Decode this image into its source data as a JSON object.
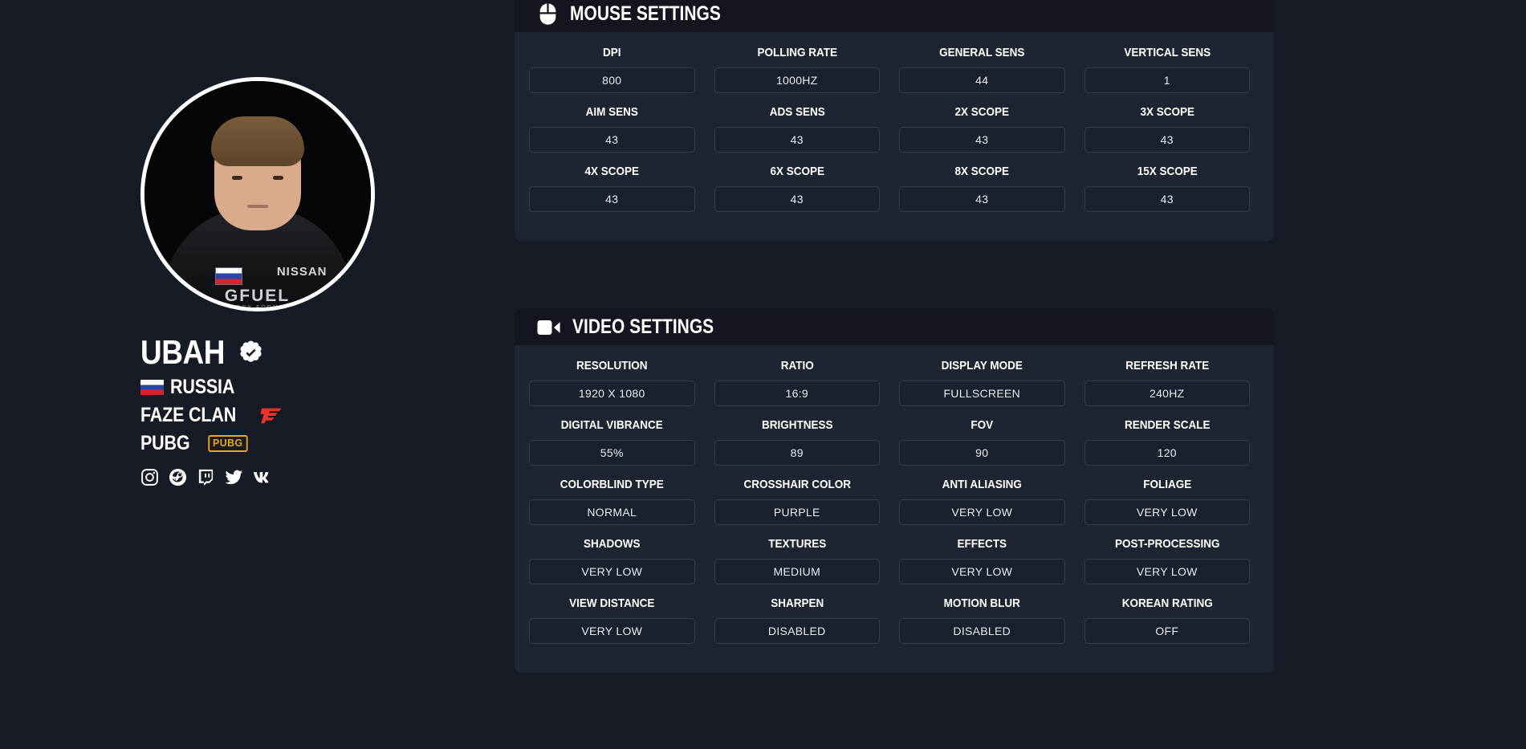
{
  "profile": {
    "avatar_alt": "player-portrait",
    "name": "UBAH",
    "verified": true,
    "country": "RUSSIA",
    "team": "FAZE CLAN",
    "game": "PUBG",
    "game_badge_label": "PUBG",
    "socials": [
      {
        "name": "instagram-icon",
        "label": "Instagram"
      },
      {
        "name": "steam-icon",
        "label": "Steam"
      },
      {
        "name": "twitch-icon",
        "label": "Twitch"
      },
      {
        "name": "twitter-icon",
        "label": "Twitter"
      },
      {
        "name": "vk-icon",
        "label": "VK"
      }
    ],
    "jersey": {
      "brand": "NISSAN",
      "sponsor": "GFUEL",
      "sponsor_sub": "ENERGY FORMULA"
    }
  },
  "colors": {
    "page_bg": "#171b26",
    "card_bg": "#1e2430",
    "card_header_bg": "#13161e",
    "value_bg": "#1b212c",
    "value_border": "#333c4d",
    "text": "#ffffff",
    "value_text": "#e9ecf2",
    "faze_red": "#e8332e",
    "pubg_gold": "#e8a61c"
  },
  "cards": [
    {
      "id": "mouse-settings",
      "title": "MOUSE SETTINGS",
      "icon": "mouse-icon",
      "fields": [
        {
          "label": "DPI",
          "value": "800"
        },
        {
          "label": "POLLING RATE",
          "value": "1000HZ"
        },
        {
          "label": "GENERAL SENS",
          "value": "44"
        },
        {
          "label": "VERTICAL SENS",
          "value": "1"
        },
        {
          "label": "AIM SENS",
          "value": "43"
        },
        {
          "label": "ADS SENS",
          "value": "43"
        },
        {
          "label": "2X SCOPE",
          "value": "43"
        },
        {
          "label": "3X SCOPE",
          "value": "43"
        },
        {
          "label": "4X SCOPE",
          "value": "43"
        },
        {
          "label": "6X SCOPE",
          "value": "43"
        },
        {
          "label": "8X SCOPE",
          "value": "43"
        },
        {
          "label": "15X SCOPE",
          "value": "43"
        }
      ]
    },
    {
      "id": "video-settings",
      "title": "VIDEO SETTINGS",
      "icon": "video-camera-icon",
      "fields": [
        {
          "label": "RESOLUTION",
          "value": "1920 X 1080"
        },
        {
          "label": "RATIO",
          "value": "16:9"
        },
        {
          "label": "DISPLAY MODE",
          "value": "FULLSCREEN"
        },
        {
          "label": "REFRESH RATE",
          "value": "240HZ"
        },
        {
          "label": "DIGITAL VIBRANCE",
          "value": "55%"
        },
        {
          "label": "BRIGHTNESS",
          "value": "89"
        },
        {
          "label": "FOV",
          "value": "90"
        },
        {
          "label": "RENDER SCALE",
          "value": "120"
        },
        {
          "label": "COLORBLIND TYPE",
          "value": "NORMAL"
        },
        {
          "label": "CROSSHAIR COLOR",
          "value": "PURPLE"
        },
        {
          "label": "ANTI ALIASING",
          "value": "VERY LOW"
        },
        {
          "label": "FOLIAGE",
          "value": "VERY LOW"
        },
        {
          "label": "SHADOWS",
          "value": "VERY LOW"
        },
        {
          "label": "TEXTURES",
          "value": "MEDIUM"
        },
        {
          "label": "EFFECTS",
          "value": "VERY LOW"
        },
        {
          "label": "POST-PROCESSING",
          "value": "VERY LOW"
        },
        {
          "label": "VIEW DISTANCE",
          "value": "VERY LOW"
        },
        {
          "label": "SHARPEN",
          "value": "DISABLED"
        },
        {
          "label": "MOTION BLUR",
          "value": "DISABLED"
        },
        {
          "label": "KOREAN RATING",
          "value": "OFF"
        }
      ]
    }
  ]
}
